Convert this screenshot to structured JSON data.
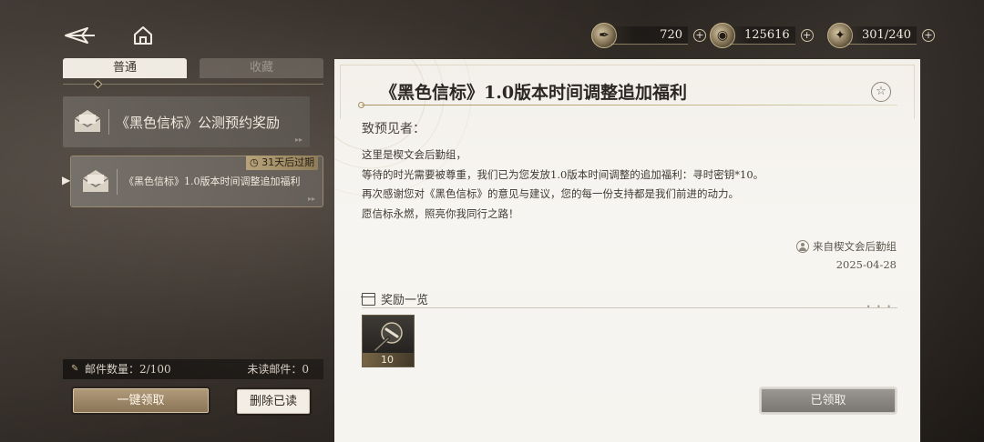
{
  "top_bar": {
    "back_icon": "back-arrow-icon",
    "home_icon": "home-icon",
    "resources": [
      {
        "icon": "quill-stamina-icon",
        "value": "720",
        "plus": "+"
      },
      {
        "icon": "gold-coin-icon",
        "value": "125616",
        "plus": "+"
      },
      {
        "icon": "compass-orb-icon",
        "value": "301/240",
        "plus": "+"
      }
    ]
  },
  "tabs": {
    "normal": "普通",
    "favorites": "收藏"
  },
  "mails": [
    {
      "title": "《黑色信标》公测预约奖励",
      "icon": "envelope-icon"
    },
    {
      "title": "《黑色信标》1.0版本时间调整追加福利",
      "icon": "envelope-icon",
      "expire": "31天后过期",
      "selected": true
    }
  ],
  "footer": {
    "count_label": "邮件数量：2/100",
    "unread_label": "未读邮件：0",
    "claim_all": "一键领取",
    "delete_read": "删除已读"
  },
  "letter": {
    "title": "《黑色信标》1.0版本时间调整追加福利",
    "greeting": "致预见者：",
    "body": [
      "这里是楔文会后勤组，",
      "等待的时光需要被尊重，我们已为您发放1.0版本时间调整的追加福利：寻时密钥*10。",
      "再次感谢您对《黑色信标》的意见与建议，您的每一份支持都是我们前进的动力。",
      "愿信标永燃，照亮你我同行之路！"
    ],
    "from": "来自楔文会后勤组",
    "date": "2025-04-28",
    "rewards_label": "奖励一览",
    "reward_item": {
      "icon": "time-key-icon",
      "qty": "10"
    },
    "claimed_button": "已领取"
  },
  "colors": {
    "accent_gold": "#c8b78f",
    "claim_button": "#a08a6a",
    "paper": "#f3f0ea"
  }
}
